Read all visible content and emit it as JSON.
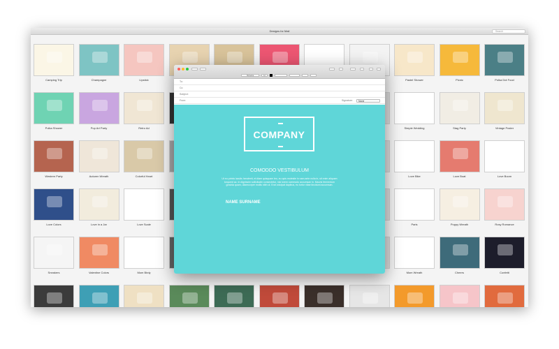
{
  "window": {
    "title": "Designs for Mail",
    "search_placeholder": "Search"
  },
  "colors": {
    "accent_teal": "#5fd6d8"
  },
  "grid": {
    "rows": [
      {
        "labels": [
          "Camping Trip",
          "Champagne",
          "Lipstick",
          "",
          "",
          "",
          "",
          "",
          "Pastel Shower",
          "Picnic",
          "Polka Dot Food"
        ],
        "colors": [
          "#fbf6e6",
          "#7ec4c4",
          "#f5c6c0",
          "#e7d3b0",
          "#d8c39a",
          "#ec5672",
          "#ffffff",
          "#f3f3f3",
          "#f7e7c9",
          "#f6b93b",
          "#4b7f86"
        ]
      },
      {
        "labels": [
          "Polka Shower",
          "Pop Art Party",
          "Retro Ad",
          "",
          "",
          "",
          "",
          "",
          "Simple Wedding",
          "Stag Party",
          "Vintage Poster"
        ],
        "colors": [
          "#6fd3b3",
          "#c9a6e0",
          "#f0e6d4",
          "#333333",
          "#ddd",
          "#ddd",
          "#ddd",
          "#ddd",
          "#ffffff",
          "#f1ede4",
          "#efe6cf"
        ]
      },
      {
        "labels": [
          "Western Party",
          "Autumn Wreath",
          "Colorful Heart",
          "",
          "",
          "",
          "",
          "",
          "Love Bike",
          "Love Boat",
          "Love Boom"
        ],
        "colors": [
          "#b5644f",
          "#efe6d9",
          "#d9c9a8",
          "#aaa",
          "#ddd",
          "#ddd",
          "#ddd",
          "#ddd",
          "#ffffff",
          "#e57b6f",
          "#ffffff"
        ]
      },
      {
        "labels": [
          "Love Colors",
          "Love in a Jar",
          "Love Scale",
          "",
          "",
          "",
          "",
          "",
          "Paris",
          "Poppy Wreath",
          "Rosy Romance"
        ],
        "colors": [
          "#2f4f8a",
          "#f2ecdd",
          "#ffffff",
          "#555",
          "#ddd",
          "#ddd",
          "#ddd",
          "#ddd",
          "#ffffff",
          "#f6efe2",
          "#f7d3cf"
        ]
      },
      {
        "labels": [
          "Sneakers",
          "Valentine Colors",
          "Mom Birdy",
          "",
          "",
          "",
          "",
          "",
          "Mom Wreath",
          "Cheers",
          "Confetti"
        ],
        "colors": [
          "#f5f5f5",
          "#f08a63",
          "#ffffff",
          "#666",
          "#ddd",
          "#ddd",
          "#ddd",
          "#ddd",
          "#ffffff",
          "#3e6b7a",
          "#1d1d2b"
        ]
      },
      {
        "labels": [],
        "colors": [
          "#3b3b3b",
          "#3e9fb5",
          "#efe0c3",
          "#5a8a5a",
          "#3d6b55",
          "#c04a3a",
          "#3a2f2a",
          "#e6e6e6",
          "#f39a2b",
          "#f6c5c9",
          "#e16b3e"
        ]
      }
    ]
  },
  "mail": {
    "toolbar": {
      "font": "Helvetica",
      "size": "12"
    },
    "fields": {
      "to": "To:",
      "cc": "Cc:",
      "subject": "Subject:",
      "from": "From:",
      "signature_label": "Signature:",
      "signature_value": "None"
    },
    "template": {
      "logo": "COMPANY",
      "heading": "COMODDO VESTIBULUM",
      "body": "Ut eu primis iaculis hendrerit, et diam quisquam leo, eu quis molestie in nam ante nulla in, sit enim aliquam torquent ac. In dignissim sollicitudin consectetur, nisi lorem commodo accumsan in. Mauris fermentum gravida quam, ullamcorper mollis nibh ut. Erat volutpat dapibus, eu tortor vitae tincidunt accumsan.",
      "signature": "NAME SURNAME"
    }
  }
}
